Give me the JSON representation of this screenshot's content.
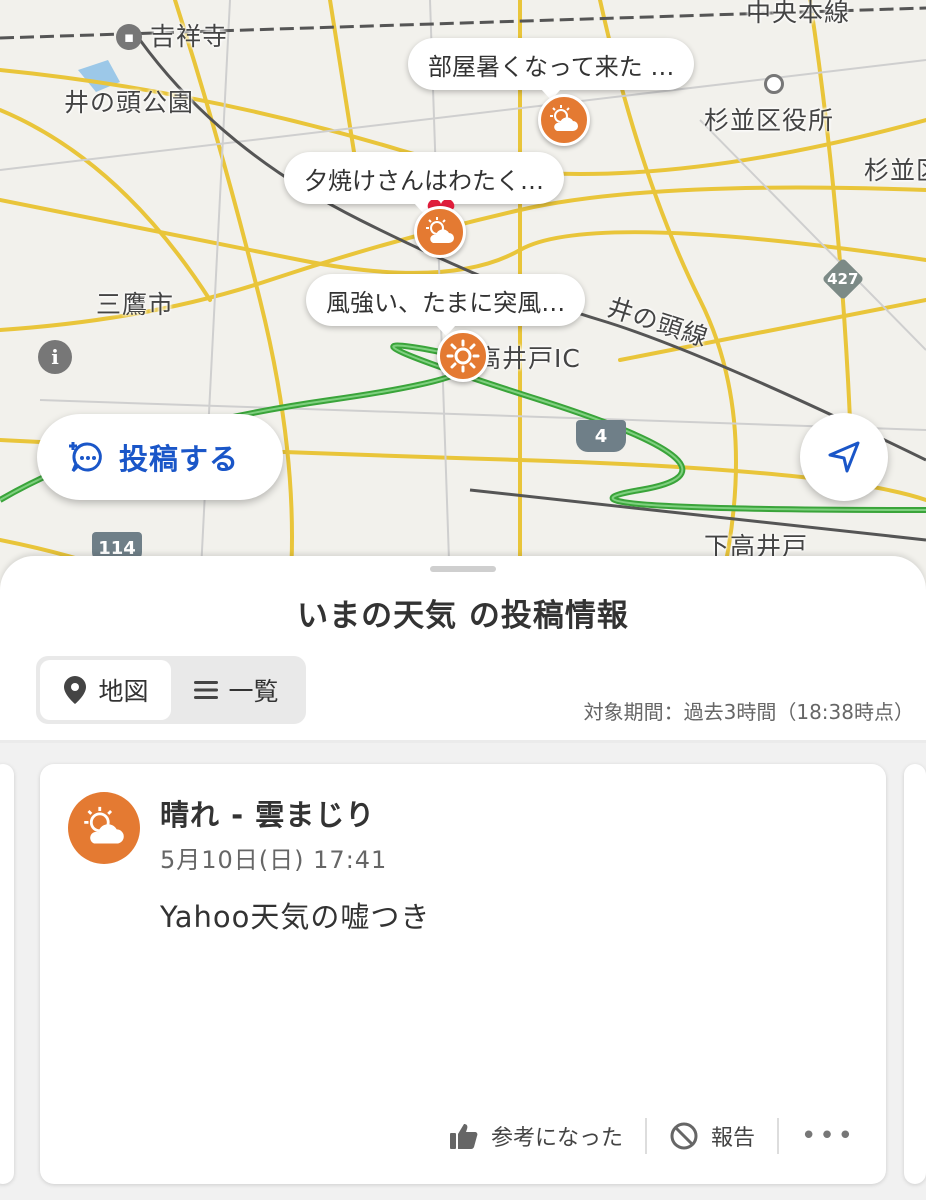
{
  "map": {
    "labels": {
      "kichijoji": "吉祥寺",
      "inokashira_park": "井の頭公園",
      "chuo_line": "中央本線",
      "suginami_office": "杉並区役所",
      "suginami": "杉並区",
      "mitaka": "三鷹市",
      "inokashira_line": "井の頭線",
      "takaido_ic": "高井戸IC",
      "shimotakaido": "下高井戸"
    },
    "route_numbers": {
      "r427": "427",
      "r4": "4",
      "r114": "114"
    },
    "posts": [
      {
        "text": "部屋暑くなって来た …",
        "weather": "sunny-cloudy"
      },
      {
        "text": "夕焼けさんはわたく…",
        "weather": "sunny-cloudy"
      },
      {
        "text": "風強い、たまに突風…",
        "weather": "sunny"
      }
    ],
    "post_button_label": "投稿する"
  },
  "sheet": {
    "title": "いまの天気 の投稿情報",
    "tabs": [
      {
        "label": "地図",
        "icon": "map-pin-icon",
        "active": true
      },
      {
        "label": "一覧",
        "icon": "list-icon",
        "active": false
      }
    ],
    "period": "対象期間：過去3時間（18:38時点）"
  },
  "card": {
    "weather_label": "晴れ - 雲まじり",
    "timestamp": "5月10日(日) 17:41",
    "body": "Yahoo天気の嘘つき",
    "helpful_label": "参考になった",
    "report_label": "報告",
    "more": "•••"
  },
  "colors": {
    "accent": "#1a56c8",
    "pin_orange": "#e47a32",
    "expressway_green": "#3aa43a",
    "road_yellow": "#e9c53a"
  }
}
